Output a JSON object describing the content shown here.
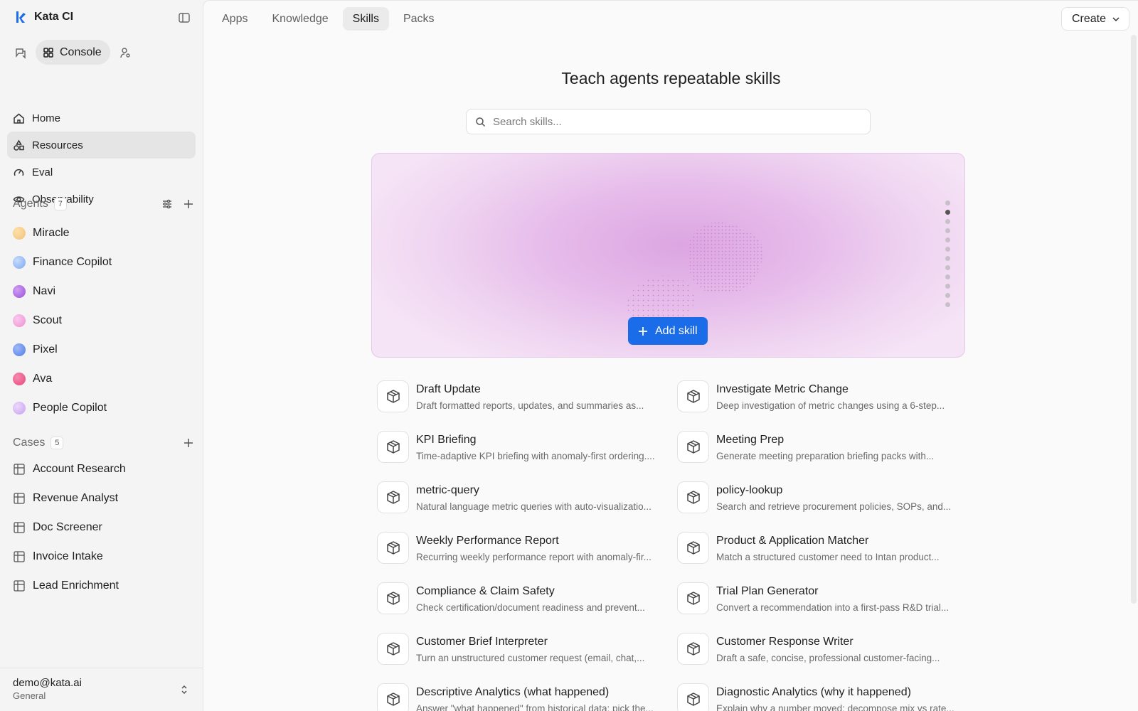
{
  "sidebar": {
    "brand": "Kata CI",
    "console_label": "Console",
    "nav": [
      {
        "label": "Home",
        "icon": "home-icon"
      },
      {
        "label": "Resources",
        "icon": "resources-icon"
      },
      {
        "label": "Eval",
        "icon": "gauge-icon"
      },
      {
        "label": "Observability",
        "icon": "eye-icon"
      }
    ],
    "agents": {
      "title": "Agents",
      "count": "7",
      "items": [
        {
          "label": "Miracle",
          "color": "#f2c27a"
        },
        {
          "label": "Finance Copilot",
          "color": "#7ba6f2"
        },
        {
          "label": "Navi",
          "color": "#9b4fd8"
        },
        {
          "label": "Scout",
          "color": "#ee8fd2"
        },
        {
          "label": "Pixel",
          "color": "#4f7ce8"
        },
        {
          "label": "Ava",
          "color": "#e8457e"
        },
        {
          "label": "People Copilot",
          "color": "#c69ff0"
        }
      ]
    },
    "cases": {
      "title": "Cases",
      "count": "5",
      "items": [
        {
          "label": "Account Research"
        },
        {
          "label": "Revenue Analyst"
        },
        {
          "label": "Doc Screener"
        },
        {
          "label": "Invoice Intake"
        },
        {
          "label": "Lead Enrichment"
        }
      ]
    },
    "user": {
      "email": "demo@kata.ai",
      "org": "General"
    }
  },
  "tabs": [
    {
      "label": "Apps"
    },
    {
      "label": "Knowledge"
    },
    {
      "label": "Skills"
    },
    {
      "label": "Packs"
    }
  ],
  "active_tab": "Skills",
  "create_label": "Create",
  "hero": {
    "title": "Teach agents repeatable skills",
    "search_placeholder": "Search skills...",
    "add_skill_label": "Add skill",
    "pager_active": 1,
    "pager_count": 12
  },
  "skills": [
    {
      "name": "Draft Update",
      "desc": "Draft formatted reports, updates, and summaries as..."
    },
    {
      "name": "Investigate Metric Change",
      "desc": "Deep investigation of metric changes using a 6-step..."
    },
    {
      "name": "KPI Briefing",
      "desc": "Time-adaptive KPI briefing with anomaly-first ordering...."
    },
    {
      "name": "Meeting Prep",
      "desc": "Generate meeting preparation briefing packs with..."
    },
    {
      "name": "metric-query",
      "desc": "Natural language metric queries with auto-visualizatio..."
    },
    {
      "name": "policy-lookup",
      "desc": "Search and retrieve procurement policies, SOPs, and..."
    },
    {
      "name": "Weekly Performance Report",
      "desc": "Recurring weekly performance report with anomaly-fir..."
    },
    {
      "name": "Product & Application Matcher",
      "desc": "Match a structured customer need to Intan product..."
    },
    {
      "name": "Compliance & Claim Safety",
      "desc": "Check certification/document readiness and prevent..."
    },
    {
      "name": "Trial Plan Generator",
      "desc": "Convert a recommendation into a first-pass R&D trial..."
    },
    {
      "name": "Customer Brief Interpreter",
      "desc": "Turn an unstructured customer request (email, chat,..."
    },
    {
      "name": "Customer Response Writer",
      "desc": "Draft a safe, concise, professional customer-facing..."
    },
    {
      "name": "Descriptive Analytics (what happened)",
      "desc": "Answer \"what happened\" from historical data: pick the..."
    },
    {
      "name": "Diagnostic Analytics (why it happened)",
      "desc": "Explain why a number moved: decompose mix vs rate..."
    }
  ]
}
